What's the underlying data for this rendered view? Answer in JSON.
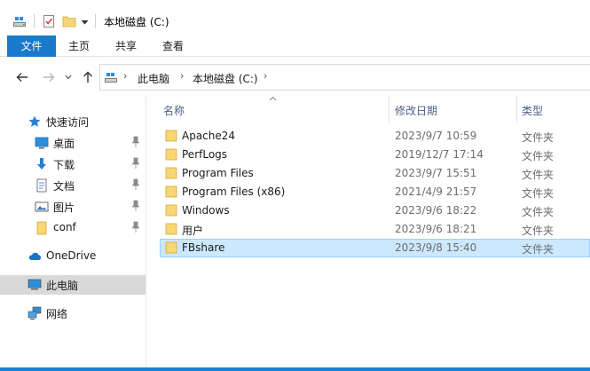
{
  "window": {
    "title": "本地磁盘 (C:)"
  },
  "ribbon": {
    "tabs": [
      {
        "label": "文件"
      },
      {
        "label": "主页"
      },
      {
        "label": "共享"
      },
      {
        "label": "查看"
      }
    ]
  },
  "address": {
    "crumbs": [
      {
        "label": "此电脑"
      },
      {
        "label": "本地磁盘 (C:)"
      }
    ]
  },
  "sidebar": {
    "quick_access": {
      "label": "快速访问"
    },
    "pinned": [
      {
        "label": "桌面",
        "icon": "desktop-icon"
      },
      {
        "label": "下载",
        "icon": "download-icon"
      },
      {
        "label": "文档",
        "icon": "document-icon"
      },
      {
        "label": "图片",
        "icon": "pictures-icon"
      },
      {
        "label": "conf",
        "icon": "folder-icon"
      }
    ],
    "onedrive": {
      "label": "OneDrive"
    },
    "this_pc": {
      "label": "此电脑"
    },
    "network": {
      "label": "网络"
    }
  },
  "columns": {
    "name": "名称",
    "date": "修改日期",
    "type": "类型"
  },
  "files": [
    {
      "name": "Apache24",
      "date": "2023/9/7 10:59",
      "type": "文件夹"
    },
    {
      "name": "PerfLogs",
      "date": "2019/12/7 17:14",
      "type": "文件夹"
    },
    {
      "name": "Program Files",
      "date": "2023/9/7 15:51",
      "type": "文件夹"
    },
    {
      "name": "Program Files (x86)",
      "date": "2021/4/9 21:57",
      "type": "文件夹"
    },
    {
      "name": "Windows",
      "date": "2023/9/6 18:22",
      "type": "文件夹"
    },
    {
      "name": "用户",
      "date": "2023/9/6 18:21",
      "type": "文件夹"
    },
    {
      "name": "FBshare",
      "date": "2023/9/8 15:40",
      "type": "文件夹"
    }
  ],
  "colors": {
    "accent": "#1979ca",
    "selection": "#cce8ff",
    "folder": "#f8d775",
    "taskbar": "#1883d7"
  }
}
